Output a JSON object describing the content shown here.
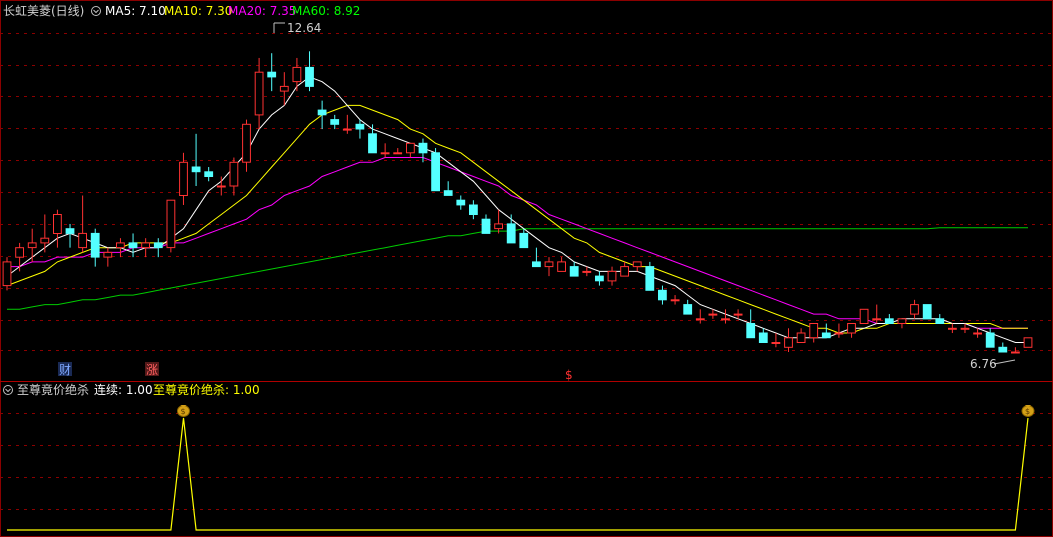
{
  "header": {
    "title": "长虹美菱(日线)",
    "ma": [
      {
        "label": "MA5: 7.10",
        "color": "#ffffff"
      },
      {
        "label": "MA10: 7.30",
        "color": "#ffff00"
      },
      {
        "label": "MA20: 7.35",
        "color": "#ff00ff"
      },
      {
        "label": "MA60: 8.92",
        "color": "#00ff00"
      }
    ]
  },
  "markers": [
    {
      "text": "财",
      "color": "#5b8cff"
    },
    {
      "text": "涨",
      "color": "#ff3030"
    },
    {
      "text": "$",
      "color": "#ff3030"
    }
  ],
  "indicator": {
    "name": "至尊竟价绝杀",
    "lianxu": "连续: 1.00",
    "value_label": "至尊竟价绝杀: 1.00",
    "signal_icon": "money-bag-icon"
  },
  "colors": {
    "up": "#ff3232",
    "down": "#54ffff",
    "ma5": "#ffffff",
    "ma10": "#ffff00",
    "ma20": "#ff00ff",
    "ma60": "#00cc00",
    "grid": "#8b0000",
    "indicator_line": "#ffff00"
  },
  "chart_data": [
    {
      "type": "candlestick",
      "title": "长虹美菱(日线)",
      "ylim": [
        6.3,
        13.3
      ],
      "high_label": "12.64",
      "low_label": "6.76",
      "ohlc": [
        [
          7.7,
          8.3,
          7.6,
          8.2
        ],
        [
          8.3,
          8.6,
          8.0,
          8.5
        ],
        [
          8.5,
          8.9,
          8.2,
          8.6
        ],
        [
          8.6,
          9.2,
          8.4,
          8.7
        ],
        [
          8.8,
          9.3,
          8.5,
          9.2
        ],
        [
          8.9,
          9.0,
          8.5,
          8.8
        ],
        [
          8.5,
          9.6,
          8.4,
          8.8
        ],
        [
          8.8,
          8.9,
          8.1,
          8.3
        ],
        [
          8.3,
          8.5,
          8.1,
          8.4
        ],
        [
          8.5,
          8.7,
          8.3,
          8.6
        ],
        [
          8.6,
          8.8,
          8.3,
          8.5
        ],
        [
          8.5,
          8.7,
          8.3,
          8.6
        ],
        [
          8.6,
          8.7,
          8.3,
          8.5
        ],
        [
          8.5,
          9.5,
          8.4,
          9.5
        ],
        [
          9.6,
          10.5,
          9.4,
          10.3
        ],
        [
          10.2,
          10.9,
          9.8,
          10.1
        ],
        [
          10.1,
          10.2,
          9.9,
          10.0
        ],
        [
          9.8,
          10.0,
          9.6,
          9.8
        ],
        [
          9.8,
          10.4,
          9.6,
          10.3
        ],
        [
          10.3,
          11.2,
          10.1,
          11.1
        ],
        [
          11.3,
          12.5,
          11.0,
          12.2
        ],
        [
          12.2,
          12.6,
          11.8,
          12.1
        ],
        [
          11.8,
          12.2,
          11.5,
          11.9
        ],
        [
          12.0,
          12.5,
          11.8,
          12.3
        ],
        [
          12.3,
          12.64,
          11.8,
          11.9
        ],
        [
          11.4,
          11.6,
          11.0,
          11.3
        ],
        [
          11.2,
          11.3,
          11.0,
          11.1
        ],
        [
          11.0,
          11.3,
          10.9,
          11.0
        ],
        [
          11.1,
          11.2,
          10.8,
          11.0
        ],
        [
          10.9,
          11.1,
          10.5,
          10.5
        ],
        [
          10.5,
          10.7,
          10.4,
          10.5
        ],
        [
          10.5,
          10.6,
          10.5,
          10.5
        ],
        [
          10.5,
          10.6,
          10.4,
          10.7
        ],
        [
          10.7,
          10.8,
          10.3,
          10.5
        ],
        [
          10.5,
          10.6,
          9.7,
          9.7
        ],
        [
          9.7,
          9.9,
          9.6,
          9.6
        ],
        [
          9.5,
          9.6,
          9.3,
          9.4
        ],
        [
          9.4,
          9.5,
          9.1,
          9.2
        ],
        [
          9.1,
          9.2,
          8.8,
          8.8
        ],
        [
          8.9,
          9.3,
          8.8,
          9.0
        ],
        [
          9.0,
          9.2,
          8.8,
          8.6
        ],
        [
          8.8,
          8.9,
          8.5,
          8.5
        ],
        [
          8.2,
          8.5,
          8.1,
          8.1
        ],
        [
          8.1,
          8.3,
          7.9,
          8.2
        ],
        [
          8.0,
          8.3,
          8.0,
          8.2
        ],
        [
          8.1,
          8.2,
          7.9,
          7.9
        ],
        [
          8.0,
          8.1,
          7.9,
          8.0
        ],
        [
          7.9,
          8.0,
          7.7,
          7.8
        ],
        [
          7.8,
          8.1,
          7.7,
          8.0
        ],
        [
          7.9,
          8.2,
          7.9,
          8.1
        ],
        [
          8.1,
          8.2,
          8.0,
          8.2
        ],
        [
          8.1,
          8.2,
          7.6,
          7.6
        ],
        [
          7.6,
          7.7,
          7.3,
          7.4
        ],
        [
          7.4,
          7.5,
          7.3,
          7.4
        ],
        [
          7.3,
          7.4,
          7.1,
          7.1
        ],
        [
          7.0,
          7.2,
          6.9,
          7.0
        ],
        [
          7.1,
          7.2,
          7.0,
          7.1
        ],
        [
          7.0,
          7.2,
          6.9,
          7.0
        ],
        [
          7.1,
          7.2,
          7.0,
          7.1
        ],
        [
          6.9,
          7.2,
          6.7,
          6.6
        ],
        [
          6.7,
          6.8,
          6.5,
          6.5
        ],
        [
          6.5,
          6.7,
          6.4,
          6.5
        ],
        [
          6.4,
          6.8,
          6.3,
          6.6
        ],
        [
          6.5,
          6.8,
          6.5,
          6.7
        ],
        [
          6.6,
          6.8,
          6.5,
          6.9
        ],
        [
          6.7,
          6.9,
          6.6,
          6.6
        ],
        [
          6.7,
          6.9,
          6.6,
          6.7
        ],
        [
          6.7,
          6.9,
          6.6,
          6.9
        ],
        [
          6.9,
          7.2,
          6.9,
          7.2
        ],
        [
          7.0,
          7.3,
          6.9,
          7.0
        ],
        [
          7.0,
          7.1,
          6.9,
          6.9
        ],
        [
          6.9,
          7.0,
          6.8,
          7.0
        ],
        [
          7.1,
          7.4,
          7.0,
          7.3
        ],
        [
          7.3,
          7.3,
          7.1,
          7.0
        ],
        [
          7.0,
          7.1,
          6.9,
          6.9
        ],
        [
          6.8,
          6.9,
          6.7,
          6.8
        ],
        [
          6.8,
          6.9,
          6.7,
          6.8
        ],
        [
          6.7,
          6.8,
          6.6,
          6.7
        ],
        [
          6.7,
          6.8,
          6.6,
          6.4
        ],
        [
          6.4,
          6.5,
          6.3,
          6.3
        ],
        [
          6.3,
          6.4,
          6.3,
          6.3
        ],
        [
          6.4,
          6.6,
          6.4,
          6.6
        ]
      ],
      "ma5": [
        7.9,
        8.1,
        8.3,
        8.5,
        8.7,
        8.8,
        8.7,
        8.6,
        8.5,
        8.5,
        8.4,
        8.5,
        8.5,
        8.7,
        8.9,
        9.3,
        9.7,
        9.9,
        10.2,
        10.5,
        11.0,
        11.3,
        11.5,
        11.9,
        12.1,
        12.0,
        11.8,
        11.5,
        11.2,
        11.0,
        10.9,
        10.8,
        10.7,
        10.6,
        10.5,
        10.3,
        10.1,
        9.9,
        9.6,
        9.3,
        9.1,
        8.9,
        8.7,
        8.5,
        8.4,
        8.2,
        8.1,
        8.0,
        8.0,
        8.0,
        8.0,
        7.9,
        7.8,
        7.7,
        7.5,
        7.3,
        7.2,
        7.1,
        7.0,
        6.9,
        6.8,
        6.7,
        6.6,
        6.6,
        6.6,
        6.6,
        6.7,
        6.8,
        6.8,
        6.9,
        6.9,
        7.0,
        7.0,
        7.0,
        7.0,
        6.9,
        6.9,
        6.8,
        6.7,
        6.6,
        6.5,
        6.5
      ],
      "ma10": [
        7.7,
        7.8,
        7.9,
        8.0,
        8.2,
        8.3,
        8.4,
        8.5,
        8.5,
        8.5,
        8.6,
        8.6,
        8.6,
        8.6,
        8.7,
        8.8,
        9.0,
        9.2,
        9.4,
        9.6,
        9.9,
        10.2,
        10.5,
        10.8,
        11.1,
        11.3,
        11.4,
        11.5,
        11.5,
        11.4,
        11.3,
        11.2,
        11.0,
        10.9,
        10.7,
        10.6,
        10.5,
        10.3,
        10.1,
        9.9,
        9.7,
        9.5,
        9.3,
        9.1,
        8.9,
        8.7,
        8.6,
        8.4,
        8.3,
        8.2,
        8.1,
        8.1,
        8.0,
        7.9,
        7.8,
        7.7,
        7.6,
        7.5,
        7.4,
        7.3,
        7.2,
        7.1,
        7.0,
        6.9,
        6.8,
        6.8,
        6.7,
        6.7,
        6.8,
        6.8,
        6.9,
        6.9,
        6.9,
        6.9,
        6.9,
        6.9,
        6.9,
        6.9,
        6.9,
        6.8,
        6.8,
        6.8
      ],
      "ma20": [
        8.1,
        8.1,
        8.2,
        8.2,
        8.3,
        8.3,
        8.3,
        8.4,
        8.4,
        8.4,
        8.5,
        8.5,
        8.5,
        8.6,
        8.6,
        8.7,
        8.8,
        8.9,
        9.0,
        9.1,
        9.3,
        9.4,
        9.6,
        9.7,
        9.8,
        10.0,
        10.1,
        10.2,
        10.3,
        10.3,
        10.4,
        10.4,
        10.4,
        10.4,
        10.3,
        10.2,
        10.1,
        10.0,
        9.9,
        9.8,
        9.6,
        9.5,
        9.4,
        9.2,
        9.1,
        9.0,
        8.9,
        8.8,
        8.7,
        8.6,
        8.5,
        8.4,
        8.3,
        8.2,
        8.1,
        8.0,
        7.9,
        7.8,
        7.7,
        7.6,
        7.5,
        7.4,
        7.3,
        7.2,
        7.1,
        7.1,
        7.0,
        7.0,
        7.0,
        6.9,
        6.9,
        6.9,
        6.9,
        6.9,
        6.9,
        6.9,
        6.9,
        6.8,
        6.8,
        6.8,
        6.8,
        6.8
      ],
      "ma60": [
        7.2,
        7.2,
        7.25,
        7.3,
        7.3,
        7.35,
        7.4,
        7.4,
        7.45,
        7.5,
        7.5,
        7.55,
        7.6,
        7.65,
        7.7,
        7.75,
        7.8,
        7.85,
        7.9,
        7.95,
        8.0,
        8.05,
        8.1,
        8.15,
        8.2,
        8.25,
        8.3,
        8.35,
        8.4,
        8.45,
        8.5,
        8.55,
        8.6,
        8.65,
        8.7,
        8.75,
        8.75,
        8.8,
        8.85,
        8.85,
        8.85,
        8.9,
        8.9,
        8.9,
        8.9,
        8.9,
        8.9,
        8.9,
        8.9,
        8.9,
        8.9,
        8.9,
        8.9,
        8.9,
        8.9,
        8.9,
        8.9,
        8.9,
        8.9,
        8.9,
        8.9,
        8.9,
        8.9,
        8.9,
        8.9,
        8.9,
        8.9,
        8.9,
        8.9,
        8.9,
        8.9,
        8.9,
        8.9,
        8.9,
        8.92,
        8.92,
        8.92,
        8.92,
        8.92,
        8.92,
        8.92,
        8.92
      ]
    },
    {
      "type": "line",
      "title": "至尊竟价绝杀",
      "ylim": [
        0,
        1
      ],
      "values": [
        0,
        0,
        0,
        0,
        0,
        0,
        0,
        0,
        0,
        0,
        0,
        0,
        0,
        0,
        1,
        0,
        0,
        0,
        0,
        0,
        0,
        0,
        0,
        0,
        0,
        0,
        0,
        0,
        0,
        0,
        0,
        0,
        0,
        0,
        0,
        0,
        0,
        0,
        0,
        0,
        0,
        0,
        0,
        0,
        0,
        0,
        0,
        0,
        0,
        0,
        0,
        0,
        0,
        0,
        0,
        0,
        0,
        0,
        0,
        0,
        0,
        0,
        0,
        0,
        0,
        0,
        0,
        0,
        0,
        0,
        0,
        0,
        0,
        0,
        0,
        0,
        0,
        0,
        0,
        0,
        0,
        1
      ]
    }
  ]
}
